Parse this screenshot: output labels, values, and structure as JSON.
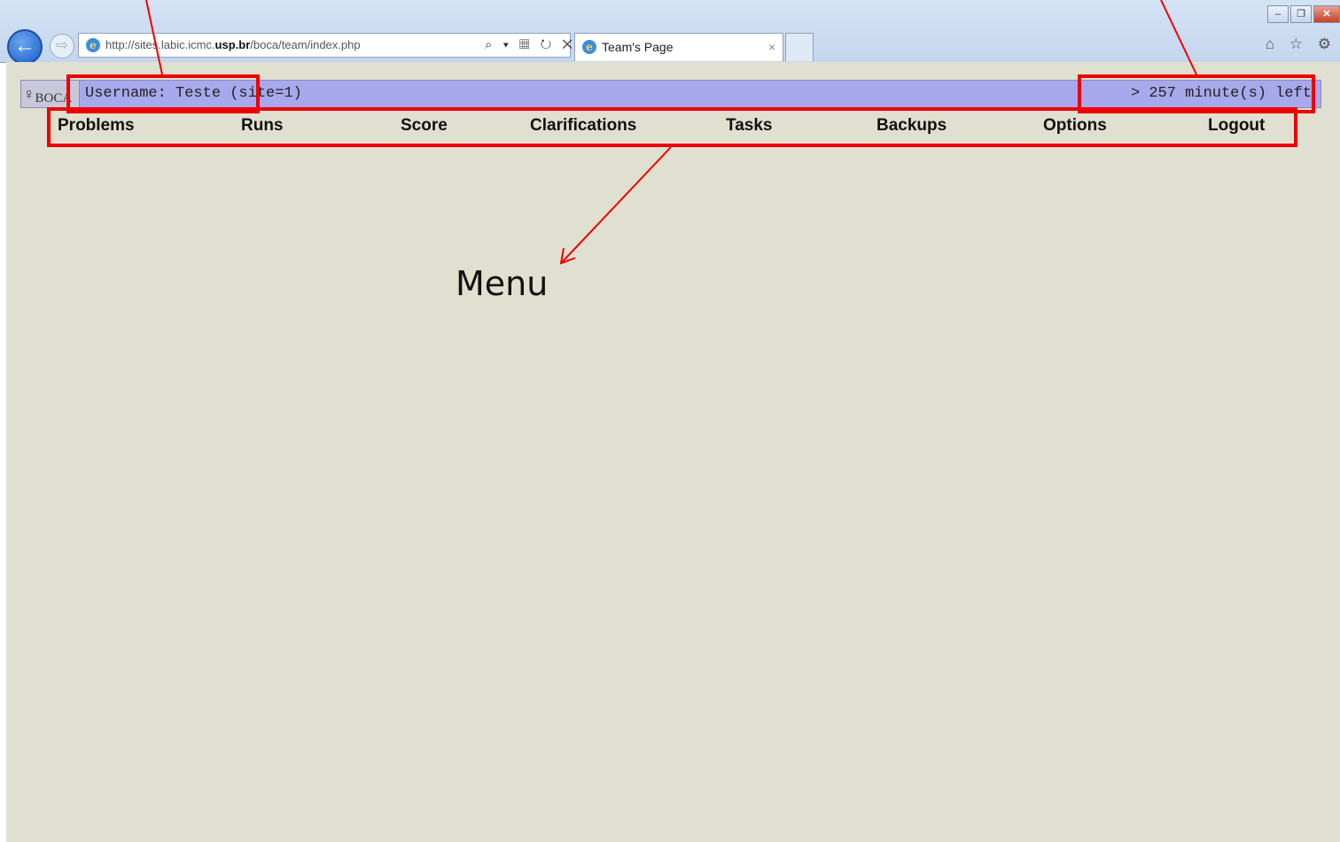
{
  "browser": {
    "url": "http://sites.labic.icmc.usp.br/boca/team/index.php",
    "tab_title": "Team's Page",
    "tab_close": "×",
    "back_glyph": "←",
    "forward_glyph": "⇨",
    "ie_glyph": "e",
    "address_actions": "⌕ ▾ ▦ ↻ ✕",
    "window_controls": [
      "–",
      "❐",
      "✕"
    ],
    "tools_glyphs": "⌂ ☆ ⚙"
  },
  "header": {
    "logo_glyph": "♀",
    "logo_text": "BOCA",
    "username": "Username: Teste (site=1)",
    "time_left": "> 257 minute(s) left"
  },
  "menu": {
    "items": [
      {
        "label": "Problems"
      },
      {
        "label": "Runs"
      },
      {
        "label": "Score"
      },
      {
        "label": "Clarifications"
      },
      {
        "label": "Tasks"
      },
      {
        "label": "Backups"
      },
      {
        "label": "Options"
      },
      {
        "label": "Logout"
      }
    ]
  },
  "annotations": {
    "menu_label": "Menu",
    "color": "#ee0000"
  },
  "colors": {
    "page_background": "#e0e0d0",
    "header_bar": "#a8a8ec"
  }
}
